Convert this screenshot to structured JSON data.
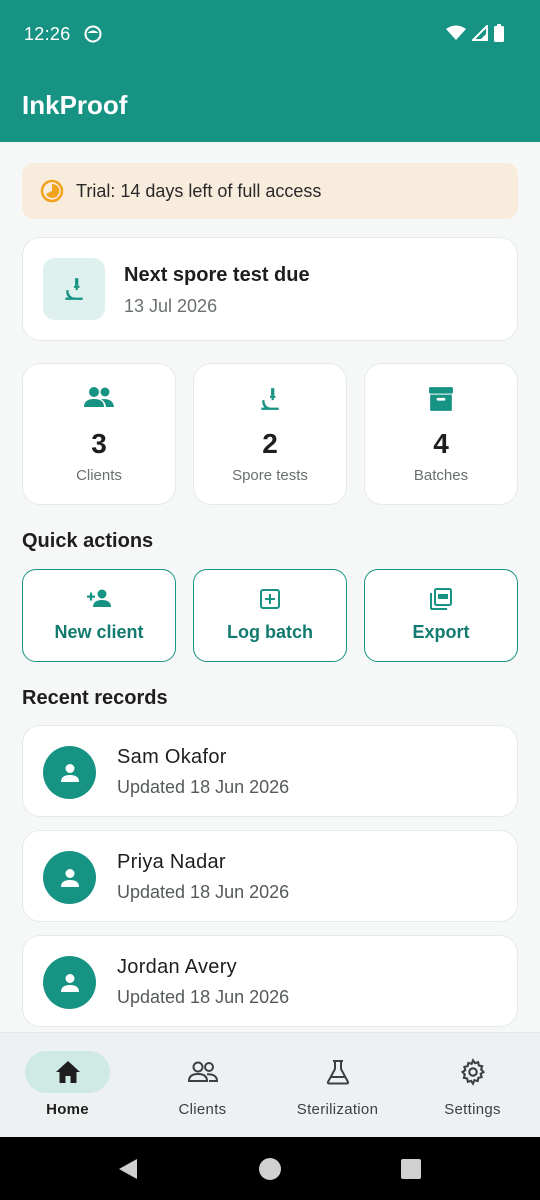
{
  "status": {
    "time": "12:26"
  },
  "app": {
    "title": "InkProof"
  },
  "trial": {
    "text": "Trial: 14 days left of full access"
  },
  "spore": {
    "title": "Next spore test due",
    "date": "13 Jul 2026"
  },
  "stats": [
    {
      "value": "3",
      "label": "Clients",
      "icon": "people-icon"
    },
    {
      "value": "2",
      "label": "Spore tests",
      "icon": "microscope-icon"
    },
    {
      "value": "4",
      "label": "Batches",
      "icon": "archive-box-icon"
    }
  ],
  "quick_actions": {
    "title": "Quick actions",
    "items": [
      {
        "label": "New client",
        "icon": "person-add-icon"
      },
      {
        "label": "Log batch",
        "icon": "add-box-icon"
      },
      {
        "label": "Export",
        "icon": "pdf-icon"
      }
    ]
  },
  "recent": {
    "title": "Recent records",
    "items": [
      {
        "name": "Sam Okafor",
        "sub": "Updated 18 Jun 2026"
      },
      {
        "name": "Priya Nadar",
        "sub": "Updated 18 Jun 2026"
      },
      {
        "name": "Jordan Avery",
        "sub": "Updated 18 Jun 2026"
      }
    ]
  },
  "nav": {
    "items": [
      {
        "label": "Home",
        "icon": "home-icon",
        "active": true
      },
      {
        "label": "Clients",
        "icon": "people-outline-icon",
        "active": false
      },
      {
        "label": "Sterilization",
        "icon": "flask-icon",
        "active": false
      },
      {
        "label": "Settings",
        "icon": "gear-icon",
        "active": false
      }
    ]
  },
  "colors": {
    "primary": "#179384",
    "trial_bg": "#f8ecdc",
    "accent_orange": "#f2a21b"
  }
}
